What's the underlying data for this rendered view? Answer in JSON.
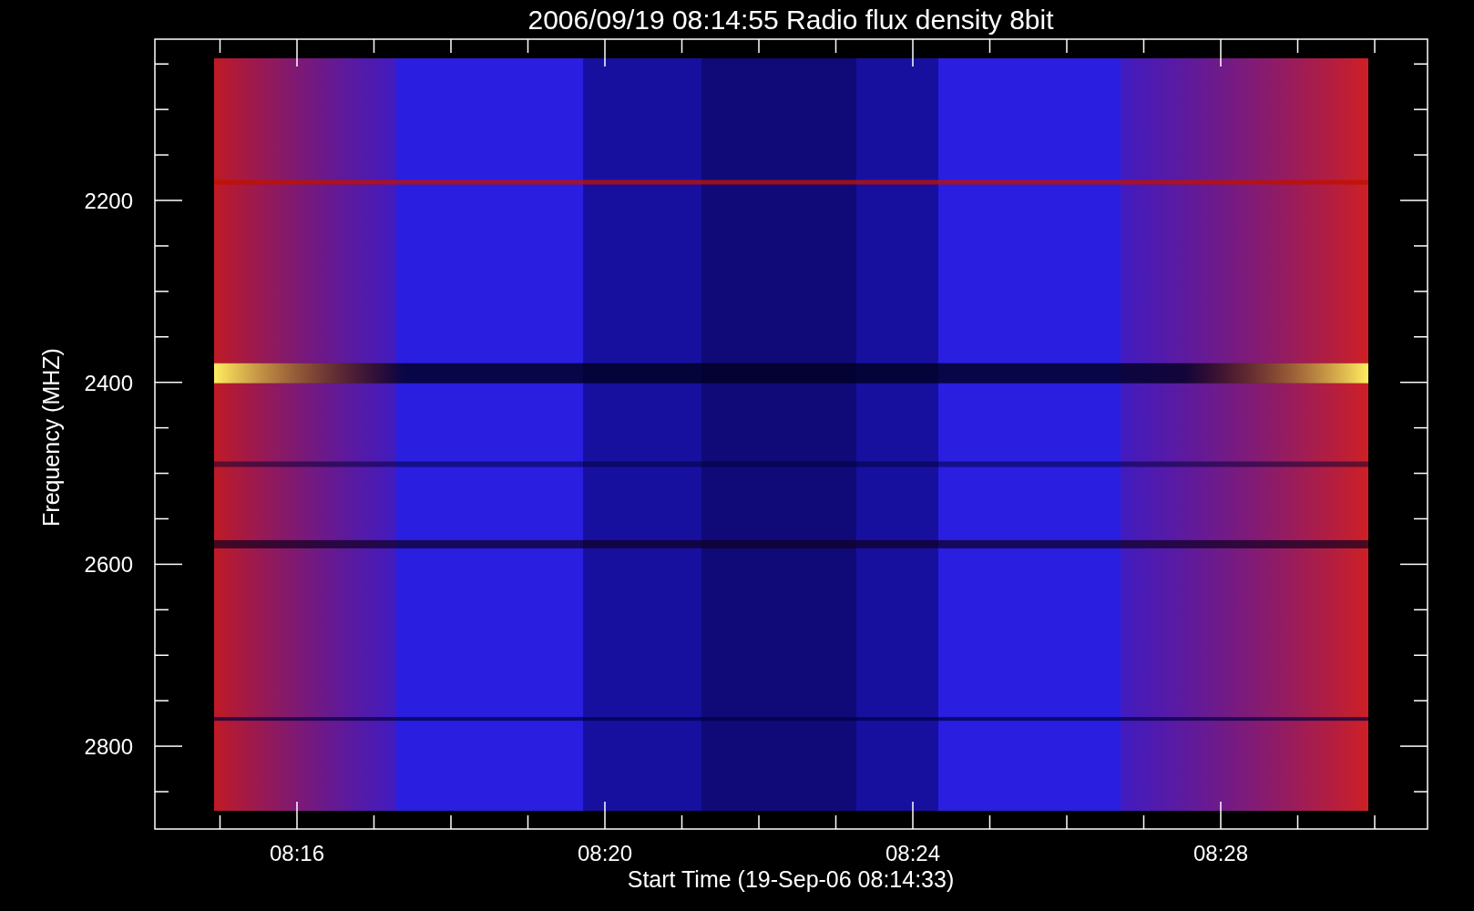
{
  "title": "2006/09/19 08:14:55 Radio flux density 8bit",
  "x_axis": {
    "label": "Start Time (19-Sep-06 08:14:33)",
    "ticks": [
      "08:16",
      "08:20",
      "08:24",
      "08:28"
    ]
  },
  "y_axis": {
    "label": "Frequency (MHZ)",
    "ticks": [
      "2200",
      "2400",
      "2600",
      "2800"
    ]
  }
}
